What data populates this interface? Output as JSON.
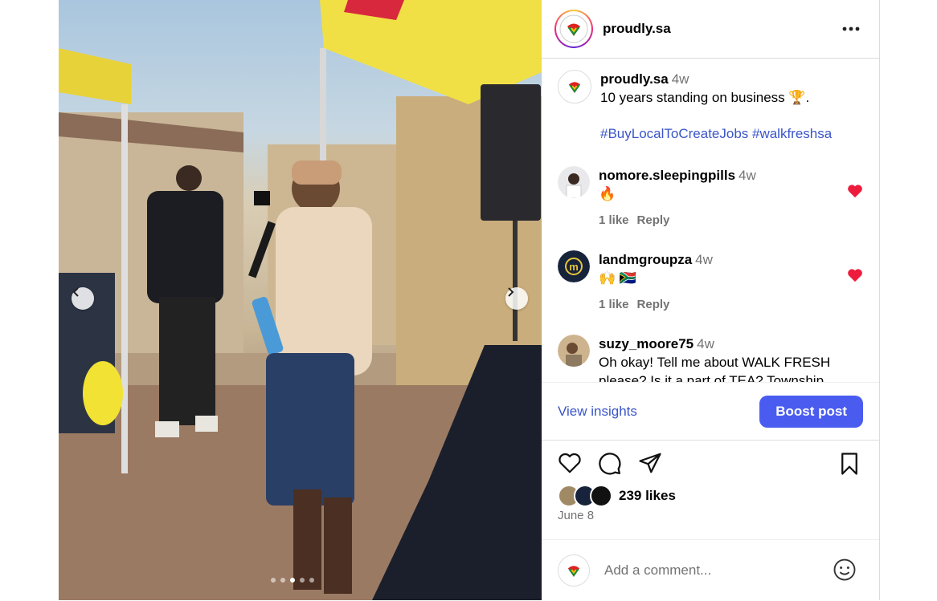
{
  "post": {
    "username": "proudly.sa",
    "caption": {
      "username": "proudly.sa",
      "time": "4w",
      "text": "10 years standing on business 🏆.",
      "hashtags": "#BuyLocalToCreateJobs #walkfreshsa"
    },
    "comments": [
      {
        "username": "nomore.sleepingpills",
        "time": "4w",
        "text": "🔥",
        "likes": "1 like",
        "reply": "Reply",
        "liked": true
      },
      {
        "username": "landmgroupza",
        "time": "4w",
        "text": "🙌 🇿🇦",
        "likes": "1 like",
        "reply": "Reply",
        "liked": true
      },
      {
        "username": "suzy_moore75",
        "time": "4w",
        "text": "Oh okay! Tell me about WALK FRESH please? Is it a part of TEA? Township"
      }
    ],
    "view_insights": "View insights",
    "boost_post": "Boost post",
    "likes": "239 likes",
    "date": "June 8",
    "add_comment_placeholder": "Add a comment...",
    "carousel": {
      "slide_count": 5,
      "active_index": 2
    }
  },
  "colors": {
    "accent": "#4a5cf0",
    "link": "#3a55c9",
    "heart": "#ed1c3c"
  },
  "icons": [
    "more-icon",
    "like-icon",
    "comment-icon",
    "share-icon",
    "save-icon",
    "emoji-icon",
    "prev-icon",
    "next-icon"
  ]
}
